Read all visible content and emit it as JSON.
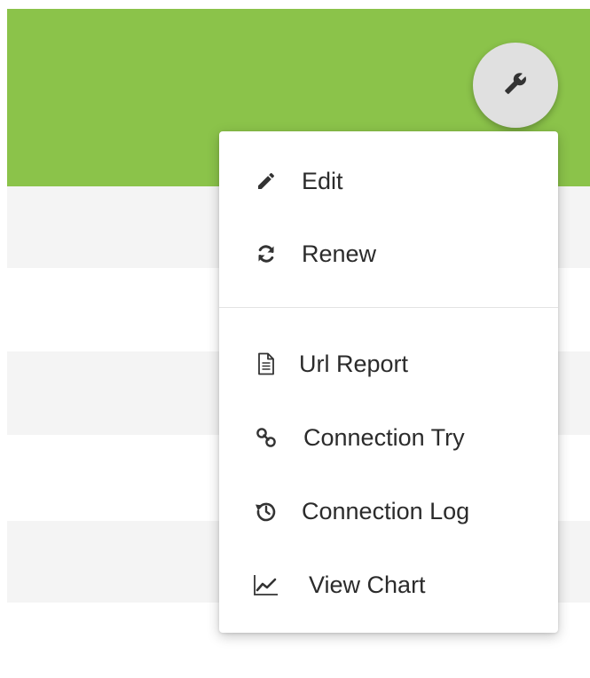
{
  "colors": {
    "header": "#8bc34a",
    "stripe": "#f4f4f4",
    "icon": "#333333"
  },
  "toolbar": {
    "tool_icon": "wrench-icon"
  },
  "menu": {
    "groups": [
      {
        "items": [
          {
            "label": "Edit",
            "icon": "pencil-icon"
          },
          {
            "label": "Renew",
            "icon": "refresh-icon"
          }
        ]
      },
      {
        "items": [
          {
            "label": "Url Report",
            "icon": "document-icon"
          },
          {
            "label": "Connection Try",
            "icon": "link-icon"
          },
          {
            "label": "Connection Log",
            "icon": "history-icon"
          },
          {
            "label": "View Chart",
            "icon": "line-chart-icon"
          }
        ]
      }
    ]
  }
}
